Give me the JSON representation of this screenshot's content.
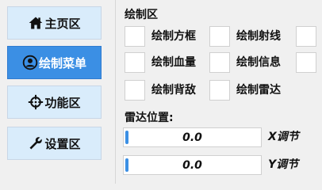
{
  "sidebar": {
    "items": [
      {
        "label": "主页区",
        "icon": "home-icon",
        "active": false
      },
      {
        "label": "绘制菜单",
        "icon": "user-icon",
        "active": true
      },
      {
        "label": "功能区",
        "icon": "crosshair-icon",
        "active": false
      },
      {
        "label": "设置区",
        "icon": "wrench-icon",
        "active": false
      }
    ]
  },
  "draw_section": {
    "title": "绘制区",
    "options": [
      {
        "label": "绘制方框",
        "checked": false
      },
      {
        "label": "绘制射线",
        "checked": false
      },
      {
        "label": "绘制血量",
        "checked": false
      },
      {
        "label": "绘制信息",
        "checked": false
      },
      {
        "label": "绘制背敌",
        "checked": false
      },
      {
        "label": "绘制雷达",
        "checked": false
      }
    ]
  },
  "radar_section": {
    "title": "雷达位置:",
    "sliders": [
      {
        "value": "0.0",
        "label": "X调节",
        "fraction": 0.0
      },
      {
        "value": "0.0",
        "label": "Y调节",
        "fraction": 0.0
      }
    ]
  },
  "colors": {
    "accent": "#3b8fe4",
    "nav_inactive": "#d9ecfb",
    "background": "#f0f0f0"
  }
}
